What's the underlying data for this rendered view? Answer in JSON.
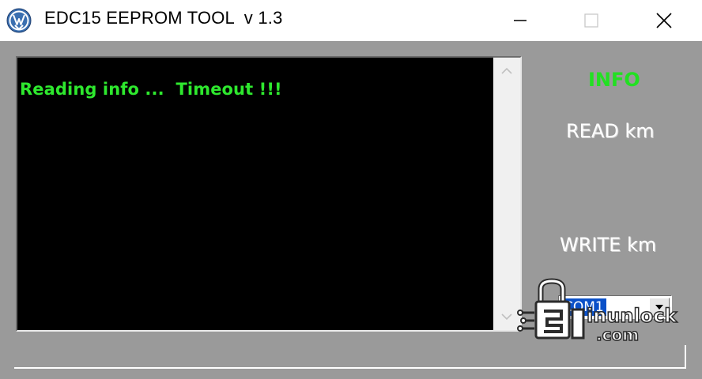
{
  "window": {
    "title": "EDC15 EEPROM TOOL  v 1.3",
    "icon": "vw-logo-icon",
    "controls": {
      "minimize": "minimize-icon",
      "maximize": "maximize-icon",
      "close": "close-icon"
    }
  },
  "console": {
    "text": "Reading info ...  Timeout !!!",
    "text_color": "#2ee82e",
    "background": "#000000"
  },
  "buttons": {
    "info": "INFO",
    "read_km": "READ km",
    "write_km": "WRITE km"
  },
  "port": {
    "selected": "COM1"
  },
  "watermark": {
    "line1": "inunlock",
    "line2": ".com",
    "icon": "lock-logo-icon"
  },
  "colors": {
    "client_background": "#9a9a9a",
    "info_green": "#22e022",
    "selection_blue": "#0a50c8"
  }
}
